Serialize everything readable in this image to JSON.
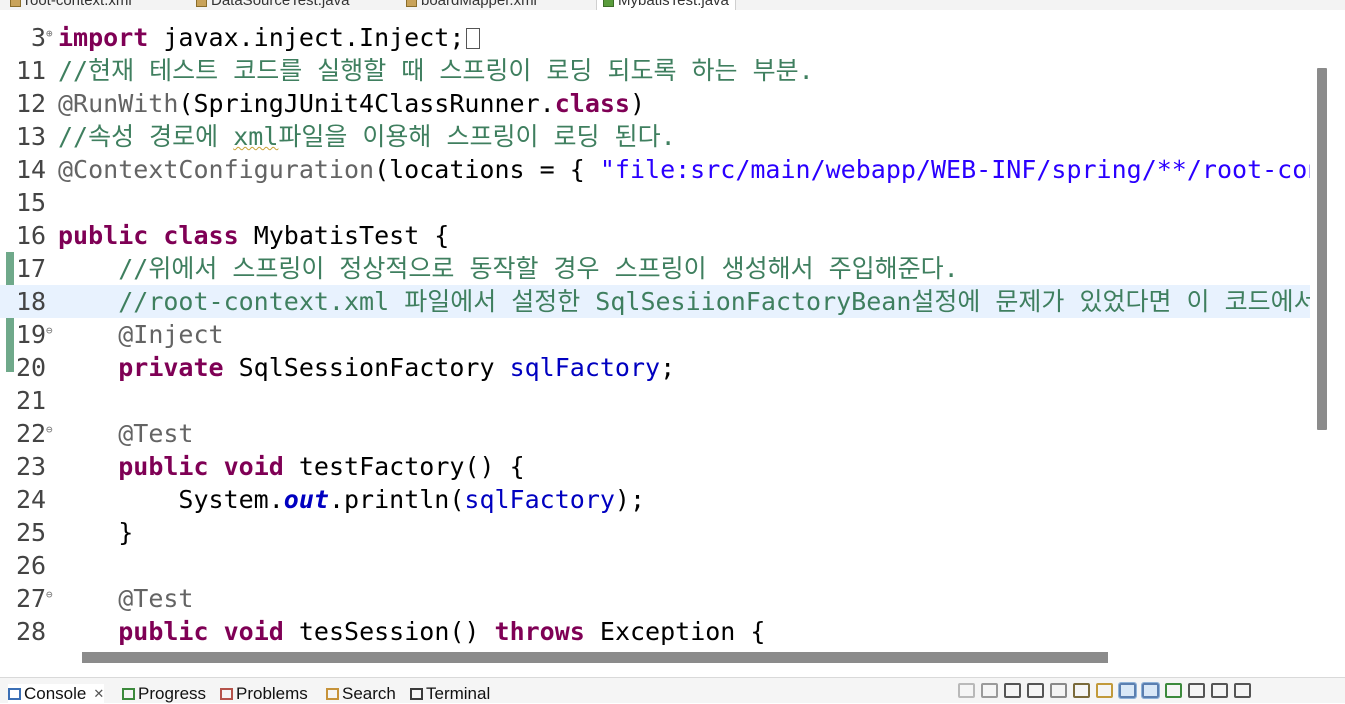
{
  "editor_tabs": [
    {
      "label": "root-context.xml",
      "active": false
    },
    {
      "label": "DataSourceTest.java",
      "active": false
    },
    {
      "label": "boardMapper.xml",
      "active": false
    },
    {
      "label": "MybatisTest.java",
      "active": true
    }
  ],
  "lines": [
    {
      "n": "3",
      "fold": "⊕",
      "tokens": [
        {
          "t": "import",
          "c": "kw"
        },
        {
          "t": " javax.inject.Inject;"
        }
      ],
      "box": true
    },
    {
      "n": "11",
      "tokens": [
        {
          "t": "//현재 테스트 코드를 실행할 때 스프링이 로딩 되도록 하는 부분.",
          "c": "cm"
        }
      ]
    },
    {
      "n": "12",
      "tokens": [
        {
          "t": "@RunWith",
          "c": "an"
        },
        {
          "t": "(SpringJUnit4ClassRunner."
        },
        {
          "t": "class",
          "c": "kw"
        },
        {
          "t": ")"
        }
      ]
    },
    {
      "n": "13",
      "tokens": [
        {
          "t": "//속성 경로에 ",
          "c": "cm"
        },
        {
          "t": "xml",
          "c": "cm squig"
        },
        {
          "t": "파일을 이용해 스프링이 로딩 된다.",
          "c": "cm"
        }
      ]
    },
    {
      "n": "14",
      "tokens": [
        {
          "t": "@ContextConfiguration",
          "c": "an"
        },
        {
          "t": "(locations = { "
        },
        {
          "t": "\"file:src/main/webapp/WEB-INF/spring/**/root-context.xml\"",
          "c": "st"
        }
      ]
    },
    {
      "n": "15",
      "tokens": []
    },
    {
      "n": "16",
      "tokens": [
        {
          "t": "public",
          "c": "kw"
        },
        {
          "t": " "
        },
        {
          "t": "class",
          "c": "kw"
        },
        {
          "t": " MybatisTest {"
        }
      ]
    },
    {
      "n": "17",
      "tokens": [
        {
          "t": "    "
        },
        {
          "t": "//위에서 스프링이 정상적으로 동작할 경우 스프링이 생성해서 주입해준다.",
          "c": "cm"
        }
      ]
    },
    {
      "n": "18",
      "current": true,
      "tokens": [
        {
          "t": "    "
        },
        {
          "t": "//root-context.xml 파일에서 설정한 SqlSesiionFactoryBean설정에 문제가 있었다면 이 코드에서 에러가 발생한다.",
          "c": "cm"
        }
      ]
    },
    {
      "n": "19",
      "fold": "⊖",
      "tokens": [
        {
          "t": "    "
        },
        {
          "t": "@Inject",
          "c": "an"
        }
      ]
    },
    {
      "n": "20",
      "tokens": [
        {
          "t": "    "
        },
        {
          "t": "private",
          "c": "kw"
        },
        {
          "t": " SqlSessionFactory "
        },
        {
          "t": "sqlFactory",
          "c": "fd"
        },
        {
          "t": ";"
        }
      ]
    },
    {
      "n": "21",
      "tokens": []
    },
    {
      "n": "22",
      "fold": "⊖",
      "tokens": [
        {
          "t": "    "
        },
        {
          "t": "@Test",
          "c": "an"
        }
      ]
    },
    {
      "n": "23",
      "tokens": [
        {
          "t": "    "
        },
        {
          "t": "public",
          "c": "kw"
        },
        {
          "t": " "
        },
        {
          "t": "void",
          "c": "kw"
        },
        {
          "t": " testFactory() {"
        }
      ]
    },
    {
      "n": "24",
      "tokens": [
        {
          "t": "        System."
        },
        {
          "t": "out",
          "c": "sf"
        },
        {
          "t": ".println("
        },
        {
          "t": "sqlFactory",
          "c": "fd"
        },
        {
          "t": ");"
        }
      ]
    },
    {
      "n": "25",
      "tokens": [
        {
          "t": "    }"
        }
      ]
    },
    {
      "n": "26",
      "tokens": []
    },
    {
      "n": "27",
      "fold": "⊖",
      "tokens": [
        {
          "t": "    "
        },
        {
          "t": "@Test",
          "c": "an"
        }
      ]
    },
    {
      "n": "28",
      "tokens": [
        {
          "t": "    "
        },
        {
          "t": "public",
          "c": "kw"
        },
        {
          "t": " "
        },
        {
          "t": "void",
          "c": "kw"
        },
        {
          "t": " tesSession() "
        },
        {
          "t": "throws",
          "c": "kw"
        },
        {
          "t": " Exception {"
        }
      ]
    }
  ],
  "view_tabs": [
    {
      "label": "Console",
      "icon": "console-icon",
      "icon_color": "#3b6fb5",
      "active": true
    },
    {
      "label": "Progress",
      "icon": "progress-icon",
      "icon_color": "#3c8a3c",
      "active": false
    },
    {
      "label": "Problems",
      "icon": "problems-icon",
      "icon_color": "#b5534b",
      "active": false
    },
    {
      "label": "Search",
      "icon": "search-icon",
      "icon_color": "#c6933a",
      "active": false
    },
    {
      "label": "Terminal",
      "icon": "terminal-icon",
      "icon_color": "#3b3b3b",
      "active": false
    }
  ],
  "console_close": "✕",
  "toolbar_icons": [
    "terminate-icon",
    "stop-icon",
    "remove-launch-icon",
    "remove-all-icon",
    "scroll-lock-icon",
    "word-wrap-icon",
    "show-stdout-icon",
    "pin-console-icon",
    "display-console-icon",
    "open-console-icon",
    "view-menu-icon",
    "minimize-icon",
    "maximize-icon"
  ]
}
